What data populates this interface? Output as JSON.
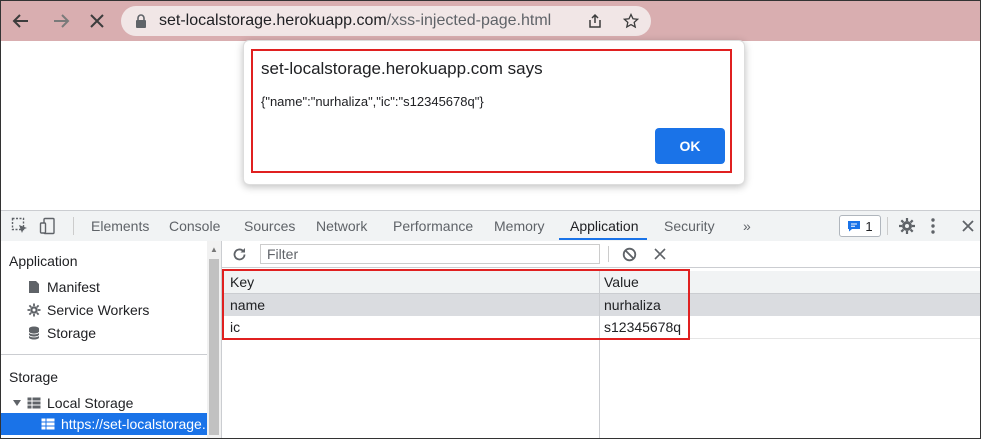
{
  "browser": {
    "url_host": "set-localstorage.herokuapp.com",
    "url_path": "/xss-injected-page.html"
  },
  "dialog": {
    "title": "set-localstorage.herokuapp.com says",
    "message": "{\"name\":\"nurhaliza\",\"ic\":\"s12345678q\"}",
    "ok_label": "OK"
  },
  "devtools": {
    "tabs": [
      "Elements",
      "Console",
      "Sources",
      "Network",
      "Performance",
      "Memory",
      "Application",
      "Security"
    ],
    "active_tab": "Application",
    "more_label": "»",
    "issues_count": "1"
  },
  "sidebar": {
    "application_heading": "Application",
    "application_items": [
      "Manifest",
      "Service Workers",
      "Storage"
    ],
    "storage_heading": "Storage",
    "local_storage_label": "Local Storage",
    "local_storage_origin": "https://set-localstorage."
  },
  "storage_view": {
    "filter_placeholder": "Filter",
    "columns": [
      "Key",
      "Value"
    ],
    "rows": [
      {
        "key": "name",
        "value": "nurhaliza"
      },
      {
        "key": "ic",
        "value": "s12345678q"
      }
    ]
  },
  "colors": {
    "highlight": "#e02020",
    "accent": "#1a73e8",
    "browser_bar": "#d9aeb0"
  }
}
